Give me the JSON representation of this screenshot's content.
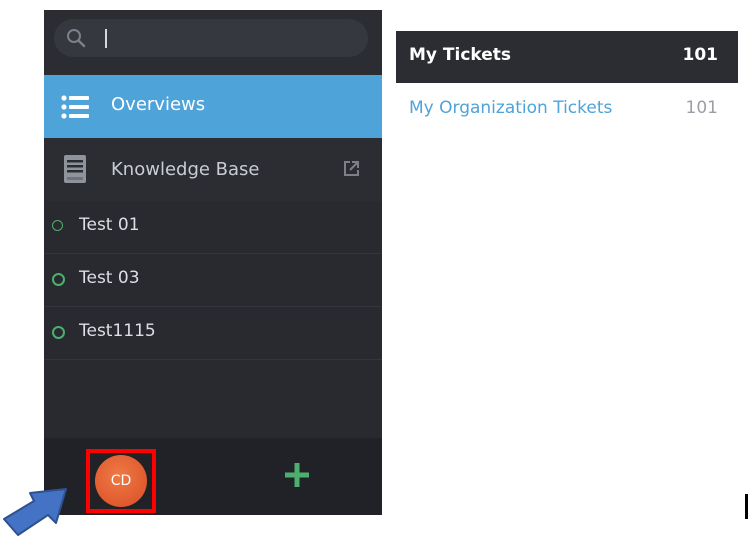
{
  "search": {
    "placeholder": "",
    "value": ""
  },
  "nav": {
    "overviews_label": "Overviews",
    "knowledge_base_label": "Knowledge Base"
  },
  "groups": [
    {
      "label": "Test 01"
    },
    {
      "label": "Test 03"
    },
    {
      "label": "Test1115"
    }
  ],
  "user": {
    "initials": "CD"
  },
  "tickets": {
    "my_tickets_label": "My Tickets",
    "my_tickets_count": "101",
    "org_tickets_label": "My Organization Tickets",
    "org_tickets_count": "101"
  },
  "colors": {
    "sidebar_bg": "#2b2d33",
    "accent_blue": "#4ea3d9",
    "status_green": "#4caf6e",
    "avatar_orange": "#e05a2e",
    "highlight_red": "#ff0000",
    "arrow_blue": "#4472c4"
  },
  "icons": {
    "search": "search-icon",
    "overviews": "list-icon",
    "knowledge_base": "book-icon",
    "external": "external-link-icon",
    "add": "plus-icon",
    "pointer": "arrow-icon"
  }
}
